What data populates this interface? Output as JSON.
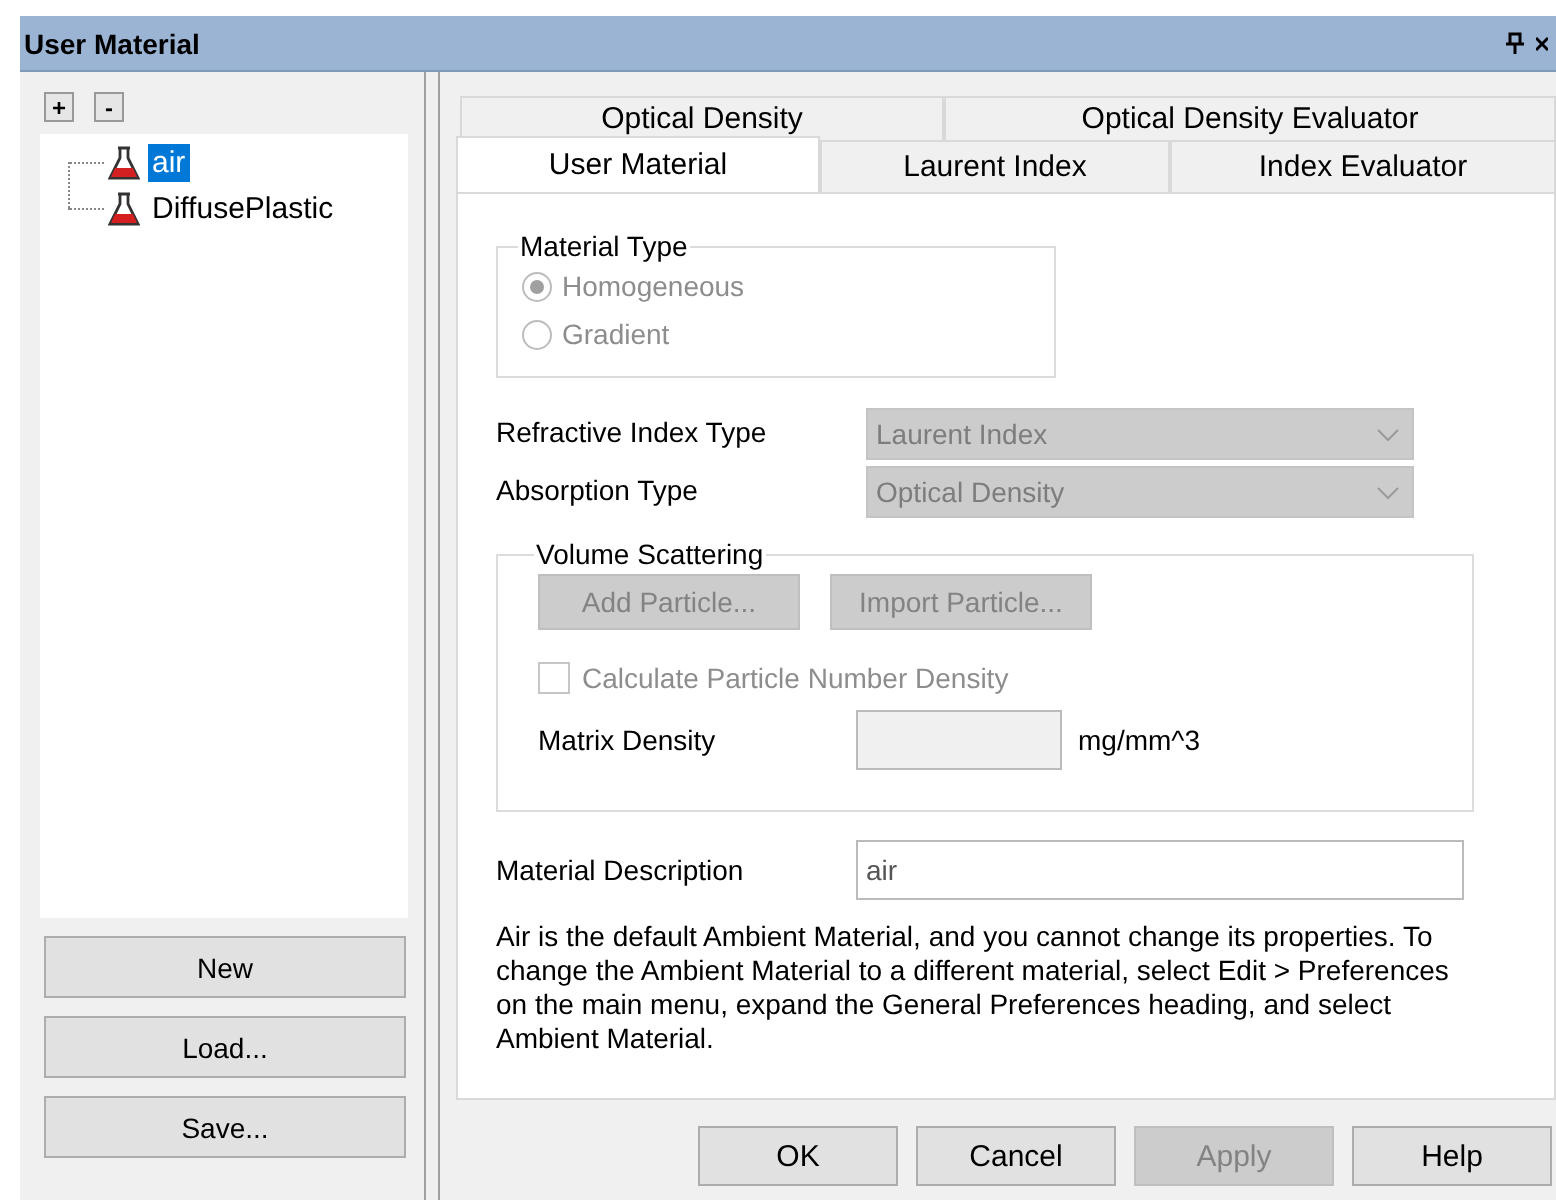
{
  "window": {
    "title": "User Material"
  },
  "tree_toolbar": [
    "+",
    "-"
  ],
  "tree": [
    {
      "label": "air",
      "selected": true
    },
    {
      "label": "DiffusePlastic",
      "selected": false
    }
  ],
  "side_buttons": [
    "New",
    "Load...",
    "Save..."
  ],
  "tabs_back_row": [
    {
      "label": "Optical Density",
      "selected": false
    },
    {
      "label": "Optical Density Evaluator",
      "selected": false
    }
  ],
  "tabs_front_row": [
    {
      "label": "User Material",
      "selected": true
    },
    {
      "label": "Laurent Index",
      "selected": false
    },
    {
      "label": "Index Evaluator",
      "selected": false
    }
  ],
  "material_type": {
    "title": "Material Type",
    "options": [
      {
        "label": "Homogeneous",
        "selected": true,
        "disabled": true
      },
      {
        "label": "Gradient",
        "selected": false,
        "disabled": true
      }
    ]
  },
  "combos": [
    {
      "label": "Refractive Index Type",
      "value": "Laurent Index",
      "disabled": true
    },
    {
      "label": "Absorption Type",
      "value": "Optical Density",
      "disabled": true
    }
  ],
  "volume_scattering": {
    "title": "Volume Scattering",
    "buttons": [
      {
        "label": "Add Particle...",
        "disabled": true
      },
      {
        "label": "Import Particle...",
        "disabled": true
      }
    ],
    "checkbox": {
      "label": "Calculate Particle Number Density",
      "checked": false,
      "disabled": true
    },
    "matrix_density": {
      "label": "Matrix Density",
      "unit": "mg/mm^3",
      "disabled": true
    }
  },
  "description": {
    "label": "Material Description",
    "value": "air"
  },
  "info": "Air is the default Ambient Material, and you cannot change its properties. To change the Ambient Material to a different material, select Edit > Preferences on the main menu, expand the General Preferences heading, and select Ambient Material.",
  "footer_buttons": [
    {
      "label": "OK",
      "disabled": false
    },
    {
      "label": "Cancel",
      "disabled": false
    },
    {
      "label": "Apply",
      "disabled": true
    },
    {
      "label": "Help",
      "disabled": false
    }
  ]
}
